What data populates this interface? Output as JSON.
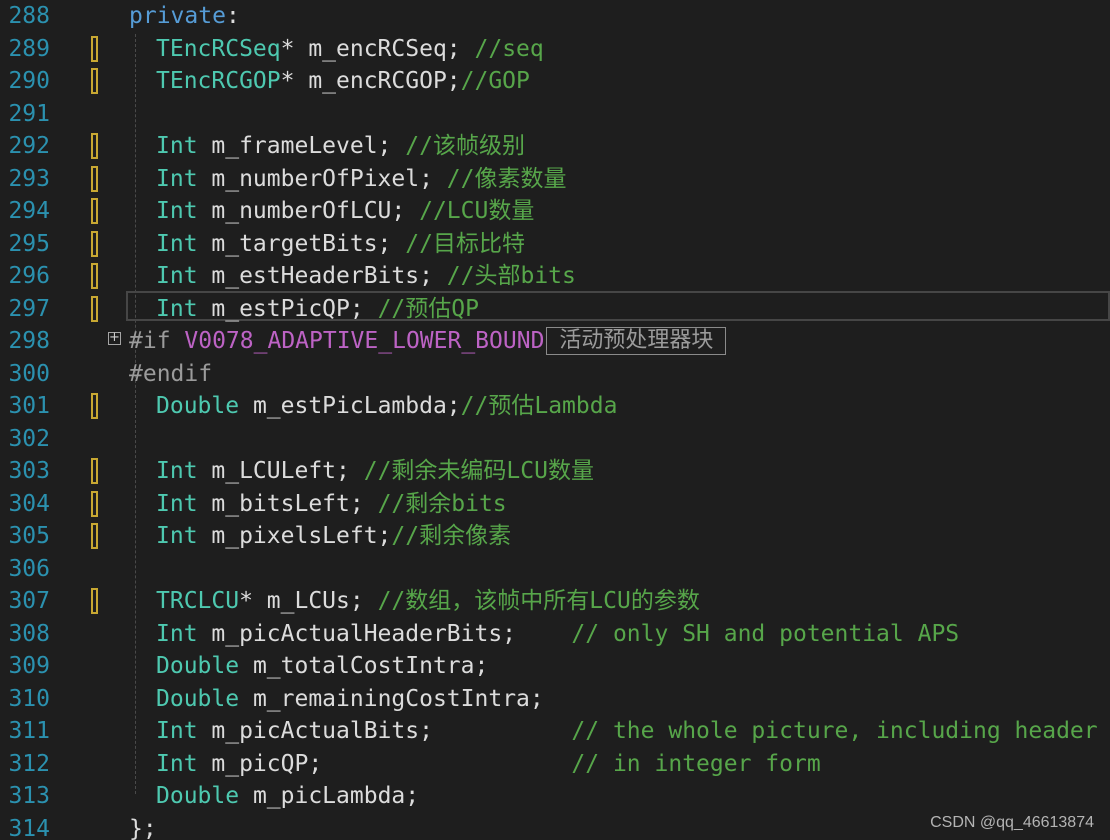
{
  "lines": [
    {
      "n": "288",
      "marker": false,
      "indent": false,
      "tokens": [
        [
          "kw",
          "private"
        ],
        [
          "id",
          ":"
        ]
      ]
    },
    {
      "n": "289",
      "marker": true,
      "indent": true,
      "tokens": [
        [
          "ty",
          "TEncRCSeq"
        ],
        [
          "id",
          "* m_encRCSeq; "
        ],
        [
          "cm",
          "//seq"
        ]
      ]
    },
    {
      "n": "290",
      "marker": true,
      "indent": true,
      "tokens": [
        [
          "ty",
          "TEncRCGOP"
        ],
        [
          "id",
          "* m_encRCGOP;"
        ],
        [
          "cm",
          "//GOP"
        ]
      ]
    },
    {
      "n": "291",
      "marker": false,
      "indent": true,
      "tokens": []
    },
    {
      "n": "292",
      "marker": true,
      "indent": true,
      "tokens": [
        [
          "ty",
          "Int"
        ],
        [
          "id",
          " m_frameLevel; "
        ],
        [
          "cm",
          "//该帧级别"
        ]
      ]
    },
    {
      "n": "293",
      "marker": true,
      "indent": true,
      "tokens": [
        [
          "ty",
          "Int"
        ],
        [
          "id",
          " m_numberOfPixel; "
        ],
        [
          "cm",
          "//像素数量"
        ]
      ]
    },
    {
      "n": "294",
      "marker": true,
      "indent": true,
      "tokens": [
        [
          "ty",
          "Int"
        ],
        [
          "id",
          " m_numberOfLCU; "
        ],
        [
          "cm",
          "//LCU数量"
        ]
      ]
    },
    {
      "n": "295",
      "marker": true,
      "indent": true,
      "tokens": [
        [
          "ty",
          "Int"
        ],
        [
          "id",
          " m_targetBits; "
        ],
        [
          "cm",
          "//目标比特"
        ]
      ]
    },
    {
      "n": "296",
      "marker": true,
      "indent": true,
      "tokens": [
        [
          "ty",
          "Int"
        ],
        [
          "id",
          " m_estHeaderBits; "
        ],
        [
          "cm",
          "//头部bits"
        ]
      ]
    },
    {
      "n": "297",
      "marker": true,
      "indent": true,
      "tokens": [
        [
          "ty",
          "Int"
        ],
        [
          "id",
          " m_estPicQP; "
        ],
        [
          "cm",
          "//预估QP"
        ]
      ]
    },
    {
      "n": "298",
      "marker": false,
      "indent": false,
      "tokens": [
        [
          "pp",
          "#if "
        ],
        [
          "mac",
          "V0078_ADAPTIVE_LOWER_BOUND"
        ]
      ],
      "collapsed": "活动预处理器块"
    },
    {
      "n": "300",
      "marker": false,
      "indent": false,
      "tokens": [
        [
          "pp",
          "#endif"
        ]
      ]
    },
    {
      "n": "301",
      "marker": true,
      "indent": true,
      "tokens": [
        [
          "ty",
          "Double"
        ],
        [
          "id",
          " m_estPicLambda;"
        ],
        [
          "cm",
          "//预估Lambda"
        ]
      ]
    },
    {
      "n": "302",
      "marker": false,
      "indent": true,
      "tokens": []
    },
    {
      "n": "303",
      "marker": true,
      "indent": true,
      "tokens": [
        [
          "ty",
          "Int"
        ],
        [
          "id",
          " m_LCULeft; "
        ],
        [
          "cm",
          "//剩余未编码LCU数量"
        ]
      ]
    },
    {
      "n": "304",
      "marker": true,
      "indent": true,
      "tokens": [
        [
          "ty",
          "Int"
        ],
        [
          "id",
          " m_bitsLeft; "
        ],
        [
          "cm",
          "//剩余bits"
        ]
      ]
    },
    {
      "n": "305",
      "marker": true,
      "indent": true,
      "tokens": [
        [
          "ty",
          "Int"
        ],
        [
          "id",
          " m_pixelsLeft;"
        ],
        [
          "cm",
          "//剩余像素"
        ]
      ]
    },
    {
      "n": "306",
      "marker": false,
      "indent": true,
      "tokens": []
    },
    {
      "n": "307",
      "marker": true,
      "indent": true,
      "tokens": [
        [
          "ty",
          "TRCLCU"
        ],
        [
          "id",
          "* m_LCUs; "
        ],
        [
          "cm",
          "//数组，该帧中所有LCU的参数"
        ]
      ]
    },
    {
      "n": "308",
      "marker": false,
      "indent": true,
      "tokens": [
        [
          "ty",
          "Int"
        ],
        [
          "id",
          " m_picActualHeaderBits;    "
        ],
        [
          "cm",
          "// only SH and potential APS"
        ]
      ]
    },
    {
      "n": "309",
      "marker": false,
      "indent": true,
      "tokens": [
        [
          "ty",
          "Double"
        ],
        [
          "id",
          " m_totalCostIntra;"
        ]
      ]
    },
    {
      "n": "310",
      "marker": false,
      "indent": true,
      "tokens": [
        [
          "ty",
          "Double"
        ],
        [
          "id",
          " m_remainingCostIntra;"
        ]
      ]
    },
    {
      "n": "311",
      "marker": false,
      "indent": true,
      "tokens": [
        [
          "ty",
          "Int"
        ],
        [
          "id",
          " m_picActualBits;          "
        ],
        [
          "cm",
          "// the whole picture, including header"
        ]
      ]
    },
    {
      "n": "312",
      "marker": false,
      "indent": true,
      "tokens": [
        [
          "ty",
          "Int"
        ],
        [
          "id",
          " m_picQP;                  "
        ],
        [
          "cm",
          "// in integer form"
        ]
      ]
    },
    {
      "n": "313",
      "marker": false,
      "indent": true,
      "tokens": [
        [
          "ty",
          "Double"
        ],
        [
          "id",
          " m_picLambda;"
        ]
      ]
    },
    {
      "n": "314",
      "marker": false,
      "indent": false,
      "tokens": [
        [
          "id",
          "};"
        ]
      ]
    }
  ],
  "current_line": "297",
  "folded_line": "298",
  "watermark": "CSDN @qq_46613874",
  "colors": {
    "background": "#1e1e1e",
    "line_number": "#2b91af",
    "keyword": "#569cd6",
    "type": "#4ec9b0",
    "comment": "#57a64a",
    "preprocessor": "#9b9b9b",
    "macro": "#bd63c5",
    "change_marker": "#c8a832"
  }
}
